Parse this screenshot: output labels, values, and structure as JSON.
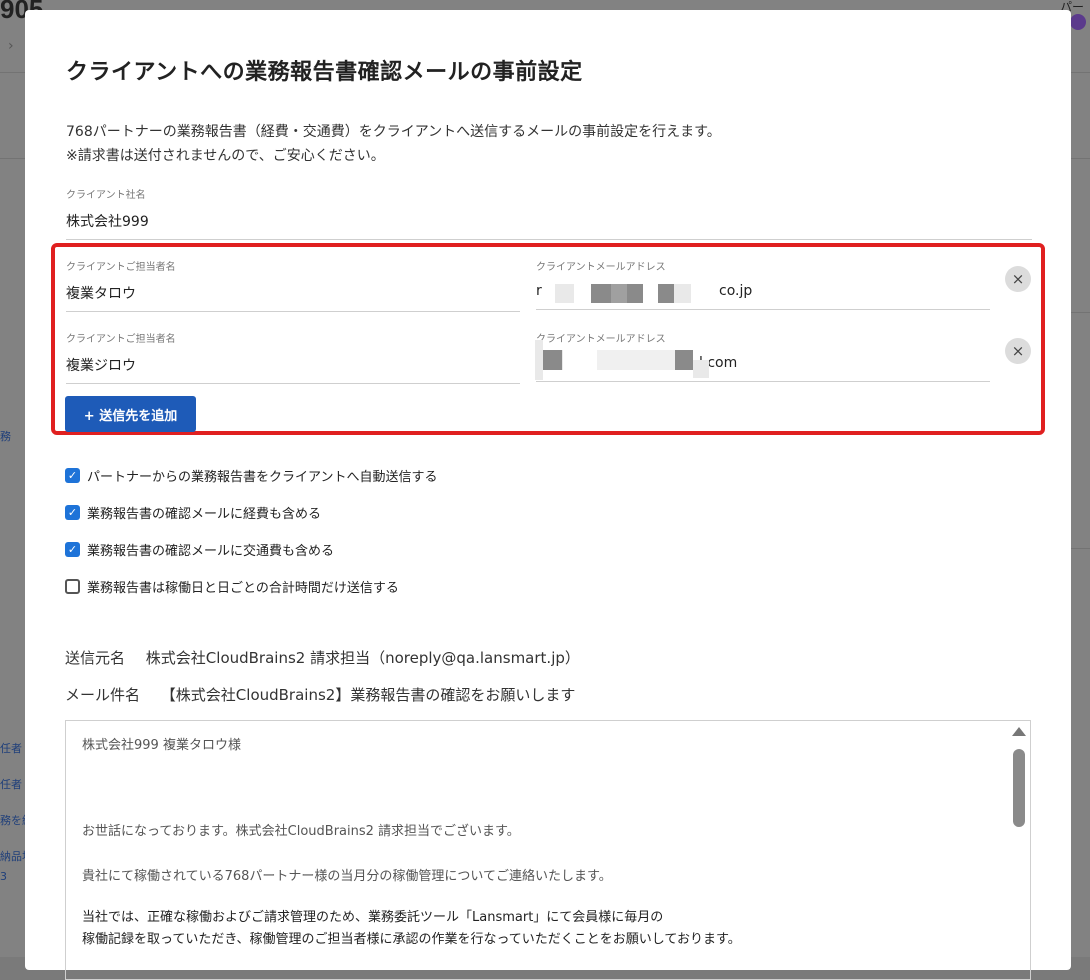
{
  "background": {
    "page_number": "905",
    "top_right_text": "パー",
    "side_labels": [
      "務",
      "任者",
      "任者",
      "務を終",
      "納品場",
      "3"
    ]
  },
  "modal": {
    "title": "クライアントへの業務報告書確認メールの事前設定",
    "description_line1": "768パートナーの業務報告書（経費・交通費）をクライアントへ送信するメールの事前設定を行えます。",
    "description_line2": "※請求書は送付されませんので、ご安心ください。",
    "client_company": {
      "label": "クライアント社名",
      "value": "株式会社999"
    },
    "recipients": [
      {
        "contact_label": "クライアントご担当者名",
        "contact_value": "複業タロウ",
        "email_label": "クライアントメールアドレス",
        "email_prefix": "r",
        "email_suffix": "co.jp"
      },
      {
        "contact_label": "クライアントご担当者名",
        "contact_value": "複業ジロウ",
        "email_label": "クライアントメールアドレス",
        "email_prefix": "",
        "email_suffix": "l.com"
      }
    ],
    "remove_label": "×",
    "add_button_label": "+ 送信先を追加",
    "checkboxes": [
      {
        "label": "パートナーからの業務報告書をクライアントへ自動送信する",
        "checked": true
      },
      {
        "label": "業務報告書の確認メールに経費も含める",
        "checked": true
      },
      {
        "label": "業務報告書の確認メールに交通費も含める",
        "checked": true
      },
      {
        "label": "業務報告書は稼働日と日ごとの合計時間だけ送信する",
        "checked": false
      }
    ],
    "sender": {
      "label": "送信元名",
      "value": "株式会社CloudBrains2 請求担当（noreply@qa.lansmart.jp）"
    },
    "subject": {
      "label": "メール件名",
      "value": "【株式会社CloudBrains2】業務報告書の確認をお願いします"
    },
    "email_body": {
      "line1": "株式会社999 複業タロウ様",
      "line2": "お世話になっております。株式会社CloudBrains2 請求担当でございます。",
      "line3": "貴社にて稼働されている768パートナー様の当月分の稼働管理についてご連絡いたします。",
      "line4": "当社では、正確な稼働およびご請求管理のため、業務委託ツール「Lansmart」にて会員様に毎月の",
      "line5": "稼働記録を取っていただき、稼働管理のご担当者様に承認の作業を行なっていただくことをお願いしております。"
    }
  },
  "colors": {
    "accent": "#1e5bb8",
    "checkbox": "#1e73d8",
    "highlight_border": "#e02020",
    "overlay": "#828282"
  }
}
